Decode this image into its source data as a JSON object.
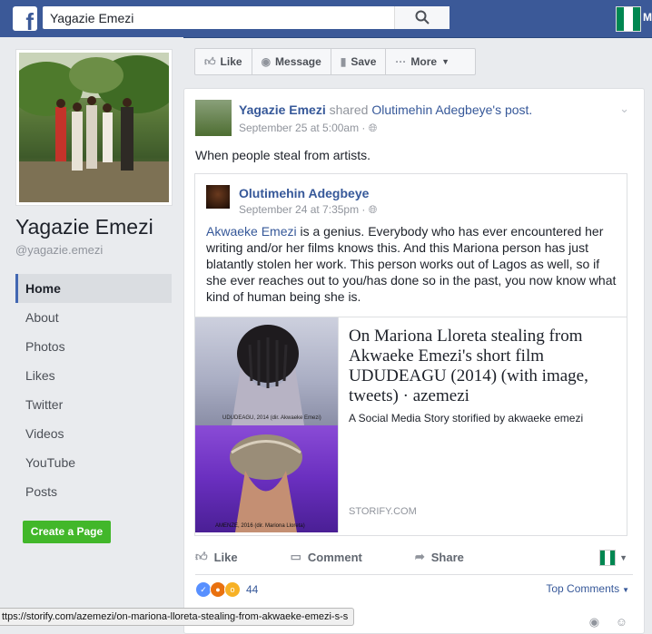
{
  "topbar": {
    "search_value": "Yagazie Emezi",
    "logo": "f",
    "user_initial": "M",
    "search_icon": "magnifier-icon"
  },
  "profile": {
    "name": "Yagazie Emezi",
    "handle": "@yagazie.emezi"
  },
  "nav": {
    "items": [
      "Home",
      "About",
      "Photos",
      "Likes",
      "Twitter",
      "Videos",
      "YouTube",
      "Posts"
    ],
    "active": "Home",
    "create_page": "Create a Page"
  },
  "page_actions": {
    "like": "Like",
    "message": "Message",
    "save": "Save",
    "more": "More"
  },
  "post": {
    "author": "Yagazie Emezi",
    "verb": "shared",
    "original_author": "Olutimehin Adegbeye",
    "suffix": "'s post.",
    "time": "September 25 at 5:00am",
    "text": "When people steal from artists.",
    "shared": {
      "author": "Olutimehin Adegbeye",
      "time": "September 24 at 7:35pm",
      "mention": "Akwaeke Emezi",
      "text": " is a genius. Everybody who has ever encountered her writing and/or her films knows this. And this Mariona person has just blatantly stolen her work. This person works out of Lagos as well, so if she ever reaches out to you/has done so in the past, you now know what kind of human being she is.",
      "link": {
        "title": "On Mariona Lloreta stealing from Akwaeke Emezi's short film UDUDEAGU (2014) (with image, tweets) · azemezi",
        "description": "A Social Media Story storified by akwaeke emezi",
        "domain": "STORIFY.COM",
        "caption_top": "UDUDEAGU, 2014 (dir. Akwaeke Emezi)",
        "caption_bottom": "AMENZE, 2016 (dir. Mariona Lloreta)"
      }
    },
    "actions": {
      "like": "Like",
      "comment": "Comment",
      "share": "Share"
    },
    "reaction_count": "44",
    "top_comments": "Top Comments"
  },
  "statusbar": {
    "url": "ttps://storify.com/azemezi/on-mariona-lloreta-stealing-from-akwaeke-emezi-s-s"
  },
  "colors": {
    "facebook_blue": "#3b5998",
    "link_blue": "#365899",
    "green": "#42b72a"
  }
}
